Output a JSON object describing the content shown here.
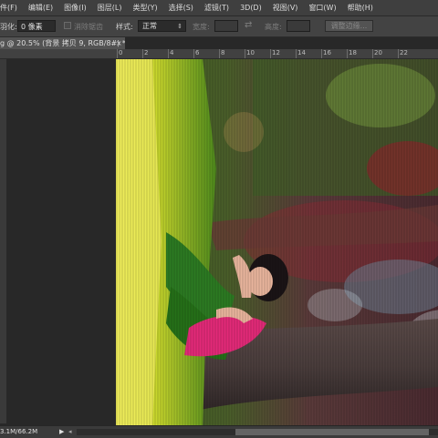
{
  "menubar": {
    "items": [
      "件(F)",
      "编辑(E)",
      "图像(I)",
      "图层(L)",
      "类型(Y)",
      "选择(S)",
      "滤镜(T)",
      "3D(D)",
      "视图(V)",
      "窗口(W)",
      "帮助(H)"
    ]
  },
  "options": {
    "feather_label": "羽化:",
    "feather_value": "0 像素",
    "antialias_label": "消除锯齿",
    "style_label": "样式:",
    "style_value": "正常",
    "width_label": "宽度:",
    "height_label": "高度:",
    "refine_edge": "调整边缘..."
  },
  "tab": {
    "title": "g @ 20.5% (背景 拷贝 9, RGB/8#) *"
  },
  "ruler": {
    "ticks": [
      "0",
      "2",
      "4",
      "6",
      "8",
      "10",
      "12",
      "14",
      "16",
      "18",
      "20",
      "22"
    ]
  },
  "status": {
    "doc_size": "3.1M/66.2M"
  },
  "colors": {
    "accent": "#3f3f3f",
    "workspace": "#282828"
  }
}
